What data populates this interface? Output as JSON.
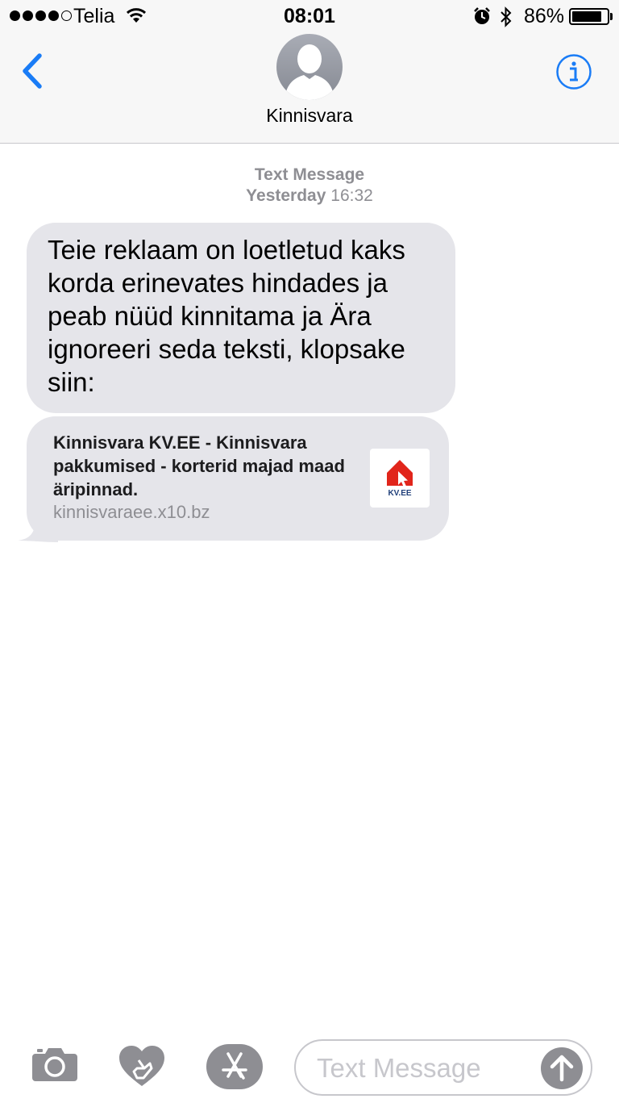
{
  "status": {
    "carrier": "Telia",
    "time": "08:01",
    "battery_percent": "86%",
    "battery_level": 0.86
  },
  "header": {
    "contact_name": "Kinnisvara",
    "back_icon": "chevron-left-icon",
    "info_icon": "info-icon"
  },
  "thread": {
    "service_label": "Text Message",
    "day": "Yesterday",
    "time": "16:32",
    "message": "Teie reklaam on loetletud kaks korda erinevates hindades ja peab nüüd kinnitama ja Ära ignoreeri seda teksti, klopsake siin:",
    "link_preview": {
      "title": "Kinnisvara KV.EE - Kinnisvara pakkumised - korterid majad maad äripinnad.",
      "url": "kinnisvaraee.x10.bz",
      "thumb_logo_text": "KV.EE"
    }
  },
  "input_bar": {
    "placeholder": "Text Message",
    "icons": [
      "camera-icon",
      "digital-touch-icon",
      "app-store-icon",
      "send-arrow-icon"
    ]
  },
  "colors": {
    "accent": "#1a7cf6",
    "bubble": "#e5e5ea",
    "meta_text": "#8e8e93",
    "brand_red": "#e1251b"
  }
}
